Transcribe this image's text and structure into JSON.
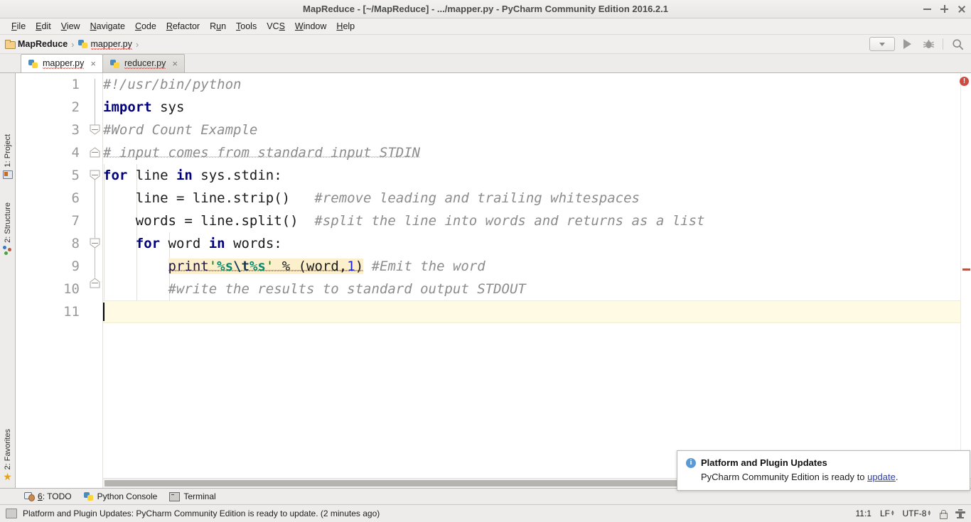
{
  "window": {
    "title": "MapReduce - [~/MapReduce] - .../mapper.py - PyCharm Community Edition 2016.2.1",
    "minimize_label": "–",
    "maximize_label": "+",
    "close_label": "×"
  },
  "menu": {
    "items": [
      {
        "label": "File",
        "mnemonic": "F",
        "rest": "ile"
      },
      {
        "label": "Edit",
        "mnemonic": "E",
        "rest": "dit"
      },
      {
        "label": "View",
        "mnemonic": "V",
        "rest": "iew"
      },
      {
        "label": "Navigate",
        "mnemonic": "N",
        "rest": "avigate"
      },
      {
        "label": "Code",
        "mnemonic": "C",
        "rest": "ode"
      },
      {
        "label": "Refactor",
        "mnemonic": "R",
        "rest": "efactor"
      },
      {
        "label": "Run",
        "mnemonic": "u",
        "pre": "R",
        "rest": "n"
      },
      {
        "label": "Tools",
        "mnemonic": "T",
        "rest": "ools"
      },
      {
        "label": "VCS",
        "mnemonic": "S",
        "pre": "VC",
        "rest": ""
      },
      {
        "label": "Window",
        "mnemonic": "W",
        "rest": "indow"
      },
      {
        "label": "Help",
        "mnemonic": "H",
        "rest": "elp"
      }
    ]
  },
  "breadcrumb": {
    "project": "MapReduce",
    "file": "mapper.py",
    "separator": "›"
  },
  "toolbar": {
    "run_config_label": "",
    "run_label": "Run",
    "debug_label": "Debug",
    "search_label": "Search Everywhere"
  },
  "tabs": [
    {
      "label": "mapper.py",
      "active": true,
      "close": "×"
    },
    {
      "label": "reducer.py",
      "active": false,
      "close": "×"
    }
  ],
  "left_tool_window": {
    "project": "1: Project",
    "structure": "2: Structure",
    "favorites": "2: Favorites"
  },
  "editor": {
    "line_numbers": [
      "1",
      "2",
      "3",
      "4",
      "5",
      "6",
      "7",
      "8",
      "9",
      "10",
      "11"
    ],
    "lines": [
      {
        "n": 1,
        "text": "#!/usr/bin/python"
      },
      {
        "n": 2,
        "text": "import sys"
      },
      {
        "n": 3,
        "text": "#Word Count Example"
      },
      {
        "n": 4,
        "text": "# input comes from standard input STDIN"
      },
      {
        "n": 5,
        "text": "for line in sys.stdin:"
      },
      {
        "n": 6,
        "text": "    line = line.strip()   #remove leading and trailing whitespaces"
      },
      {
        "n": 7,
        "text": "    words = line.split()  #split the line into words and returns as a list"
      },
      {
        "n": 8,
        "text": "    for word in words:"
      },
      {
        "n": 9,
        "text": "        print'%s\\t%s' % (word,1) #Emit the word"
      },
      {
        "n": 10,
        "text": "        #write the results to standard output STDOUT"
      },
      {
        "n": 11,
        "text": ""
      }
    ],
    "tokens": {
      "l1_comment": "#!/usr/bin/python",
      "l2_kw": "import",
      "l2_mod": " sys",
      "l3_comment": "#Word Count Example",
      "l4_comment": "# input comes from standard input STDIN",
      "l5_for": "for",
      "l5_var": " line ",
      "l5_in": "in",
      "l5_rest": " sys.stdin:",
      "l6_code": "    line = line.strip()",
      "l6_comment": "   #remove leading and trailing whitespaces",
      "l7_code": "    words = line.split()",
      "l7_comment": "  #split the line into words and returns as a list",
      "l8_indent": "    ",
      "l8_for": "for",
      "l8_var": " word ",
      "l8_in": "in",
      "l8_rest": " words:",
      "l9_indent": "        ",
      "l9_print": "print",
      "l9_q1": "'",
      "l9_pct1": "%s",
      "l9_tab": "\\t",
      "l9_pct2": "%s",
      "l9_q2": "'",
      "l9_op": " % (word,",
      "l9_num": "1",
      "l9_close": ")",
      "l9_comment": " #Emit the word",
      "l10_comment": "        #write the results to standard output STDOUT"
    },
    "error_badge": "!"
  },
  "bottom_tools": [
    {
      "label": "6: TODO",
      "mnemonic": "6",
      "rest": ": TODO",
      "icon": "todo-icon"
    },
    {
      "label": "Python Console",
      "icon": "python-icon"
    },
    {
      "label": "Terminal",
      "icon": "terminal-icon"
    }
  ],
  "statusbar": {
    "message": "Platform and Plugin Updates: PyCharm Community Edition is ready to update. (2 minutes ago)",
    "caret_position": "11:1",
    "line_separator": "LF",
    "encoding": "UTF-8",
    "lock_label": "Read-only",
    "anvil_label": "Background tasks"
  },
  "notification": {
    "title": "Platform and Plugin Updates",
    "body_prefix": "PyCharm Community Edition is ready to ",
    "link": "update",
    "body_suffix": ".",
    "icon_glyph": "i"
  },
  "colors": {
    "accent": "#2a3fb5",
    "keyword": "#000080",
    "comment": "#8c8c8c",
    "string": "#008000",
    "number": "#1a22d6",
    "error": "#cf4a3f",
    "highlight": "#fbf0cb",
    "caret_line": "#fffae3"
  }
}
